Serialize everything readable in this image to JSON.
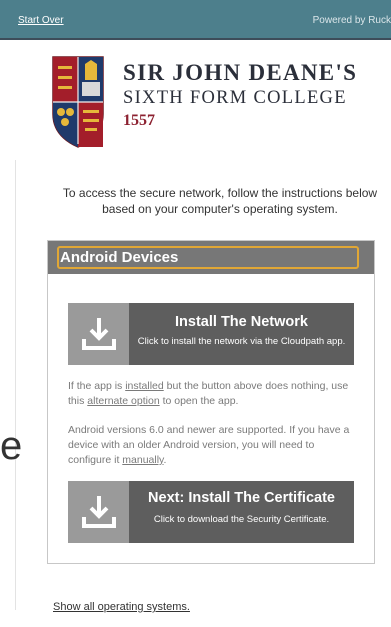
{
  "header": {
    "start_over": "Start Over",
    "powered_by": "Powered by Ruck"
  },
  "logo": {
    "line1": "SIR JOHN DEANE'S",
    "line2": "SIXTH FORM COLLEGE",
    "year": "1557",
    "colors": {
      "navy": "#1f3a6b",
      "red": "#a31e2a",
      "gold": "#e6b83a"
    }
  },
  "ghost_glyph": "e",
  "intro": "To access the secure network, follow the instructions below based on your computer's operating system.",
  "panel": {
    "title": "Android Devices",
    "install_network": {
      "title": "Install The Network",
      "subtitle": "Click to install the network via the Cloudpath app.",
      "icon": "download-icon"
    },
    "note1": {
      "part1": "If the app is ",
      "link1": "installed",
      "part2": " but the button above does nothing, use this ",
      "link2": "alternate option",
      "part3": " to open the app."
    },
    "note2": {
      "part1": "Android versions 6.0 and newer are supported. If you have a device with an older Android version, you will need to configure it ",
      "link": "manually",
      "part2": "."
    },
    "install_certificate": {
      "title": "Next: Install The Certificate",
      "subtitle": "Click to download the Security Certificate.",
      "icon": "download-icon"
    }
  },
  "footer": {
    "show_all": "Show all operating systems."
  },
  "colors": {
    "topbar": "#4d7f8c",
    "panel_header": "#777777",
    "panel_title_border": "#e1a735",
    "button_dark": "#5e5e5e",
    "button_icon_bg": "#9a9a9a"
  }
}
